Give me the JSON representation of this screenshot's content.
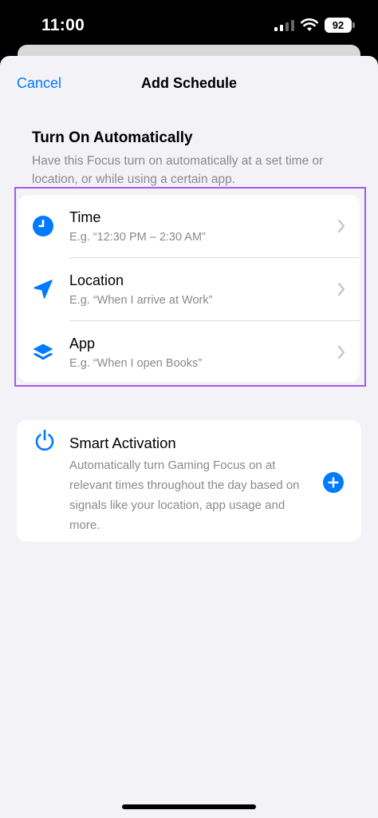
{
  "status_bar": {
    "time": "11:00",
    "battery": "92"
  },
  "nav": {
    "cancel_label": "Cancel",
    "title": "Add Schedule"
  },
  "section": {
    "title": "Turn On Automatically",
    "description": "Have this Focus turn on automatically at a set time or location, or while using a certain app."
  },
  "options": [
    {
      "label": "Time",
      "subtitle": "E.g. “12:30 PM – 2:30 AM”",
      "icon": "clock-icon"
    },
    {
      "label": "Location",
      "subtitle": "E.g. “When I arrive at Work”",
      "icon": "location-arrow-icon"
    },
    {
      "label": "App",
      "subtitle": "E.g. “When I open Books”",
      "icon": "app-stack-icon"
    }
  ],
  "smart_activation": {
    "title": "Smart Activation",
    "description": "Automatically turn Gaming Focus on at relevant times throughout the day based on signals like your location, app usage and more."
  },
  "colors": {
    "accent": "#007aff",
    "highlight": "#a45be6",
    "background": "#f2f2f7",
    "secondary_text": "#8a8a8e"
  }
}
